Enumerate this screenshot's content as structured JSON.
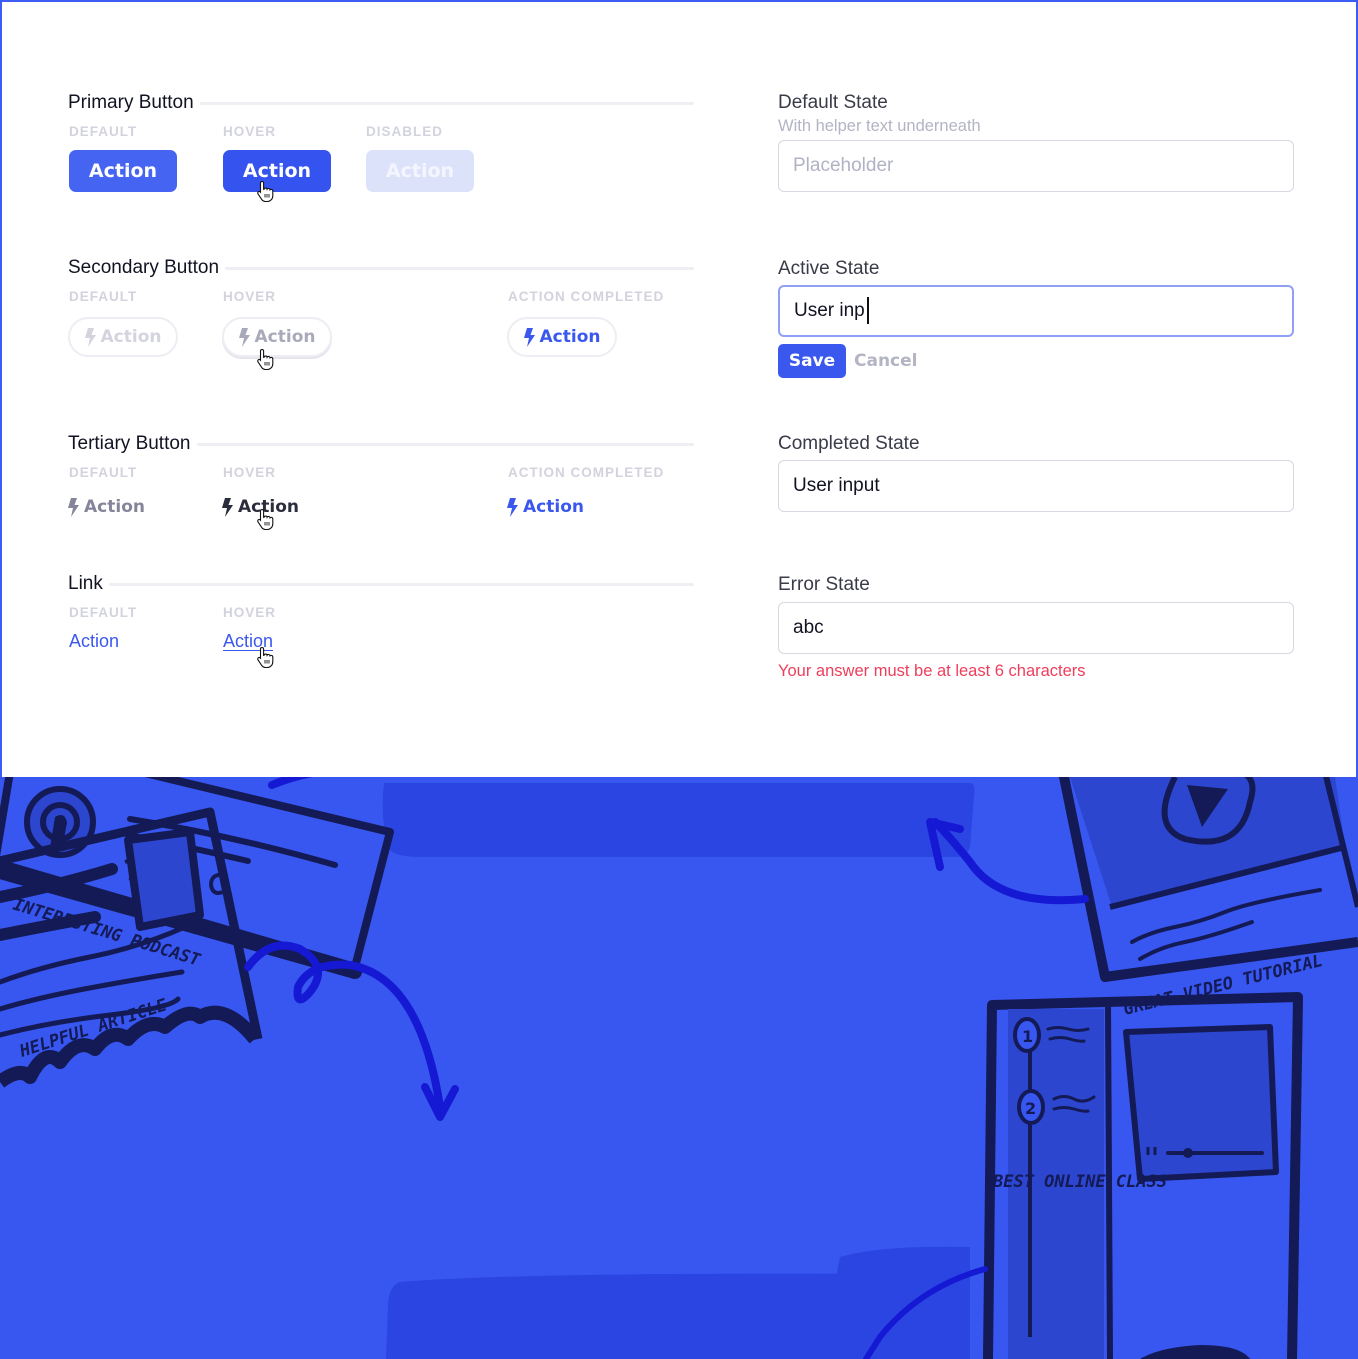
{
  "buttons": {
    "primary": {
      "title": "Primary Button",
      "states": [
        {
          "label": "DEFAULT",
          "button": "Action"
        },
        {
          "label": "HOVER",
          "button": "Action"
        },
        {
          "label": "DISABLED",
          "button": "Action"
        }
      ]
    },
    "secondary": {
      "title": "Secondary Button",
      "states": [
        {
          "label": "DEFAULT",
          "button": "Action"
        },
        {
          "label": "HOVER",
          "button": "Action"
        },
        {
          "label": "ACTION COMPLETED",
          "button": "Action"
        }
      ]
    },
    "tertiary": {
      "title": "Tertiary Button",
      "states": [
        {
          "label": "DEFAULT",
          "button": "Action"
        },
        {
          "label": "HOVER",
          "button": "Action"
        },
        {
          "label": "ACTION COMPLETED",
          "button": "Action"
        }
      ]
    },
    "link": {
      "title": "Link",
      "states": [
        {
          "label": "DEFAULT",
          "button": "Action"
        },
        {
          "label": "HOVER",
          "button": "Action"
        }
      ]
    }
  },
  "inputs": {
    "default": {
      "label": "Default State",
      "helper": "With helper text underneath",
      "placeholder": "Placeholder",
      "value": ""
    },
    "active": {
      "label": "Active State",
      "value": "User inp",
      "save": "Save",
      "cancel": "Cancel"
    },
    "completed": {
      "label": "Completed State",
      "value": "User input"
    },
    "error": {
      "label": "Error State",
      "value": "abc",
      "message": "Your answer must be at least 6 characters"
    }
  },
  "illustration": {
    "labels": {
      "podcast": "INTERESTING PODCAST",
      "video": "GREAT VIDEO TUTORIAL",
      "article": "HELPFUL ARTICLE",
      "class": "BEST ONLINE CLASS"
    },
    "class_steps": [
      "1",
      "2"
    ]
  },
  "colors": {
    "accent": "#3b58ee",
    "primary_default": "#4664f2",
    "primary_hover": "#3553ee",
    "primary_disabled": "#dde2fb",
    "error": "#ef3e5c",
    "illustration_bg": "#3857f0",
    "illustration_ink": "#131a55",
    "illustration_arrow": "#1519d4"
  }
}
